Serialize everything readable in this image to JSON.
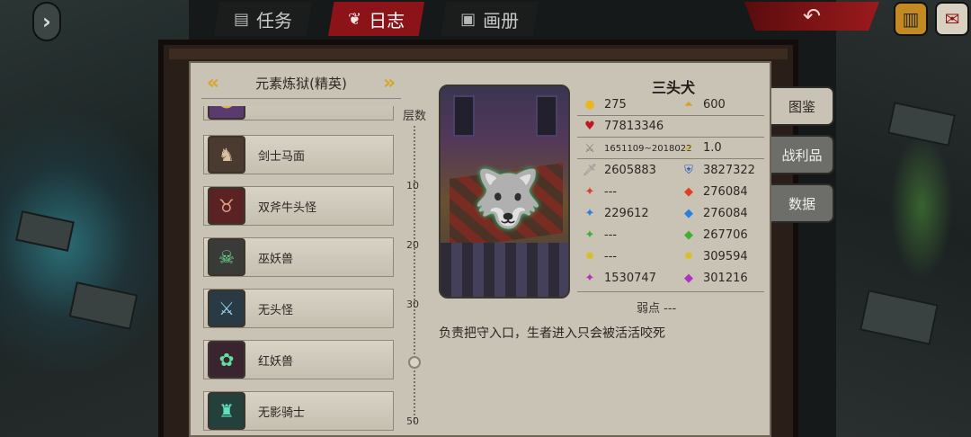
{
  "colors": {
    "tab_active": "#8c1418",
    "panel_bg": "#c8c3b5",
    "chevron": "#d9a526",
    "side_tab": "#6d6e69"
  },
  "topbar": {
    "nav_icon": "chevron-right-icon",
    "tabs": [
      {
        "label": "任务",
        "icon": "quest-scroll-icon",
        "active": false
      },
      {
        "label": "日志",
        "icon": "journal-icon",
        "active": true
      },
      {
        "label": "画册",
        "icon": "album-icon",
        "active": false
      }
    ],
    "back_icon": "return-arrow-icon",
    "corner_icons": [
      "treasure-chest-icon",
      "mail-scroll-icon"
    ]
  },
  "list": {
    "title": "元素炼狱(精英)",
    "prev_icon": "chevron-left-icon",
    "next_icon": "chevron-right-icon",
    "items": [
      {
        "name": "",
        "avatar": "purple-monster-icon",
        "selected": false
      },
      {
        "name": "剑士马面",
        "avatar": "horse-face-icon",
        "selected": false
      },
      {
        "name": "双斧牛头怪",
        "avatar": "bull-head-icon",
        "selected": false
      },
      {
        "name": "巫妖兽",
        "avatar": "lich-beast-icon",
        "selected": false
      },
      {
        "name": "无头怪",
        "avatar": "headless-icon",
        "selected": false
      },
      {
        "name": "红妖兽",
        "avatar": "red-demon-icon",
        "selected": false
      },
      {
        "name": "无影骑士",
        "avatar": "shadow-knight-icon",
        "selected": false
      }
    ]
  },
  "floors": {
    "label": "层数",
    "ticks": [
      "10",
      "20",
      "30",
      "50"
    ],
    "current_fraction": 0.8
  },
  "monster": {
    "name": "三头犬",
    "portrait_icon": "cerberus-icon",
    "gold": "275",
    "exp": "600",
    "hp": "77813346",
    "level_range": "1651109~2018022",
    "speed": "1.0",
    "attack": "2605883",
    "defense": "3827322",
    "fire_attack": "---",
    "fire_resist": "276084",
    "ice_attack": "229612",
    "ice_resist": "276084",
    "nature_attack": "---",
    "nature_resist": "267706",
    "light_attack": "---",
    "light_resist": "309594",
    "dark_attack": "1530747",
    "dark_resist": "301216",
    "weakness_label": "弱点 ---",
    "description": "负责把守入口，生者进入只会被活活咬死"
  },
  "side_tabs": [
    {
      "label": "图鉴",
      "active": true
    },
    {
      "label": "战利品",
      "active": false
    },
    {
      "label": "数据",
      "active": false
    }
  ]
}
